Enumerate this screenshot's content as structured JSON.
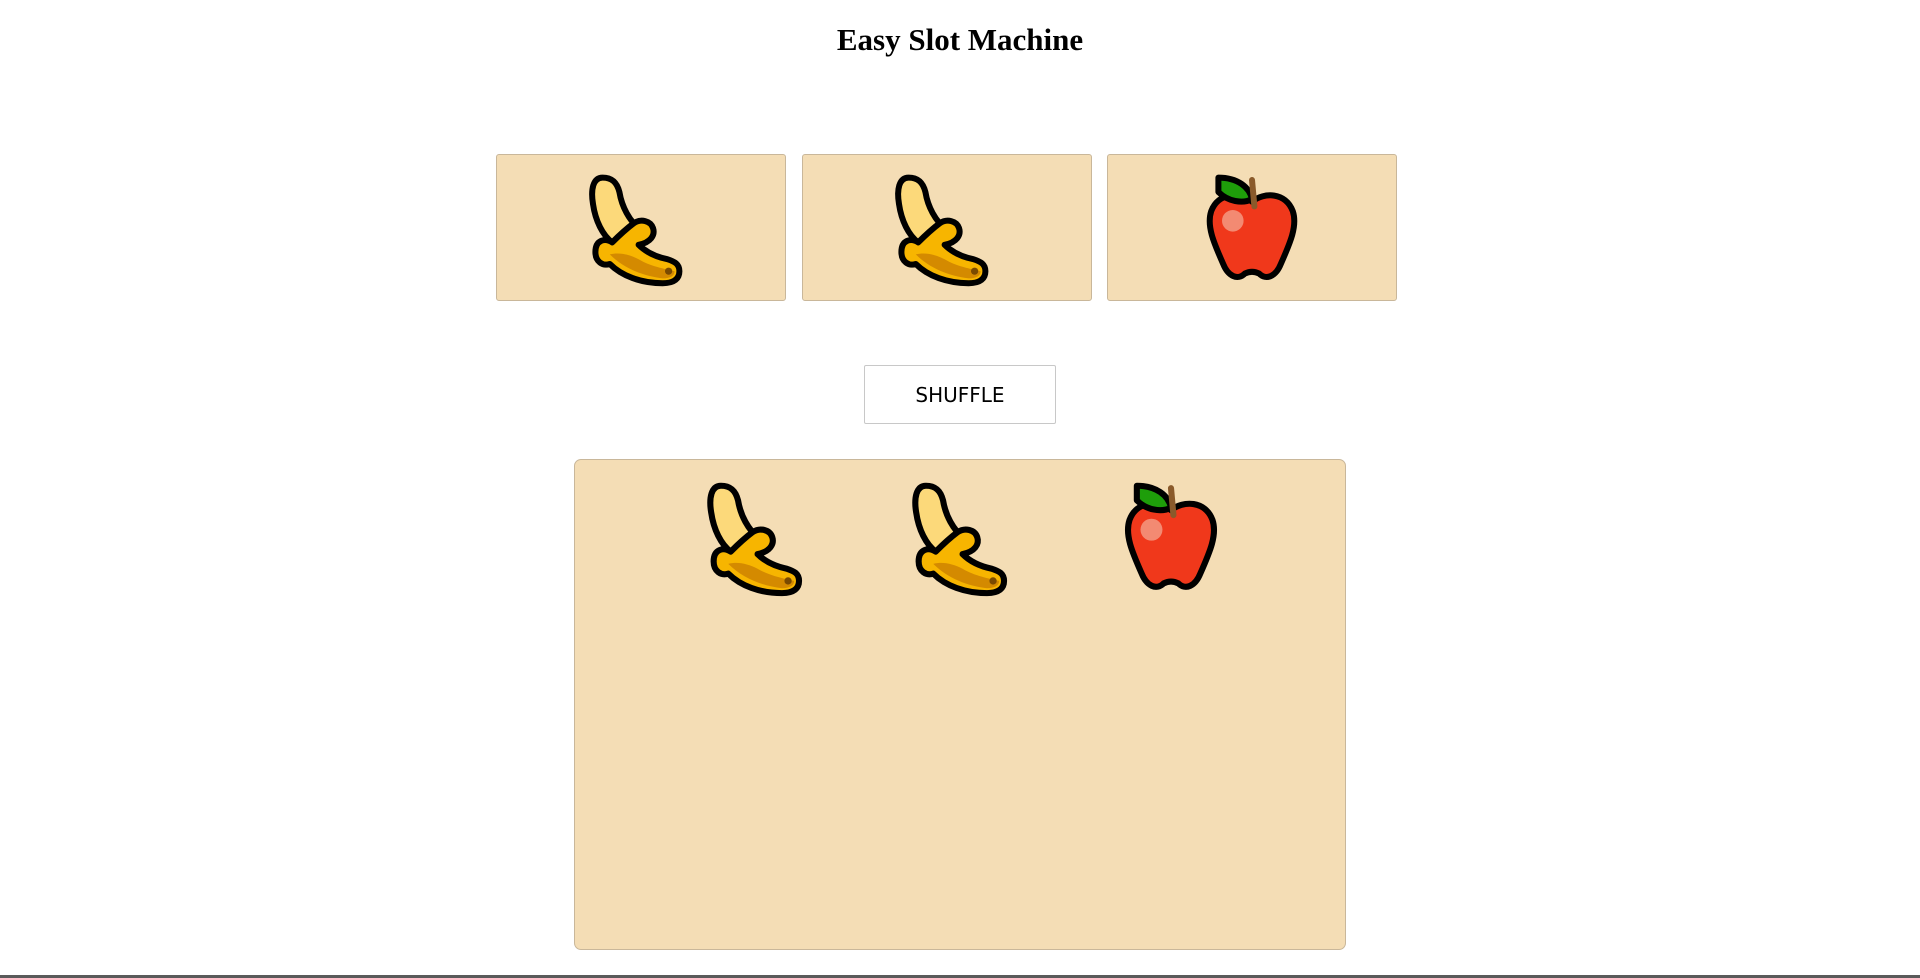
{
  "title": "Easy Slot Machine",
  "slots": [
    {
      "fruit": "banana",
      "icon": "banana-icon"
    },
    {
      "fruit": "banana",
      "icon": "banana-icon"
    },
    {
      "fruit": "apple",
      "icon": "apple-icon"
    }
  ],
  "shuffle_label": "SHUFFLE",
  "history": [
    {
      "fruit": "banana",
      "icon": "banana-icon"
    },
    {
      "fruit": "banana",
      "icon": "banana-icon"
    },
    {
      "fruit": "apple",
      "icon": "apple-icon"
    }
  ],
  "colors": {
    "panel_bg": "#f4ddb5",
    "panel_border": "#c9b79a",
    "banana_light": "#fcd97a",
    "banana_main": "#f7b500",
    "banana_dark": "#d48a00",
    "apple_red": "#f0381b",
    "apple_highlight": "#f38a72",
    "leaf_green": "#1e9e0a",
    "stem_brown": "#8a5a2b"
  }
}
